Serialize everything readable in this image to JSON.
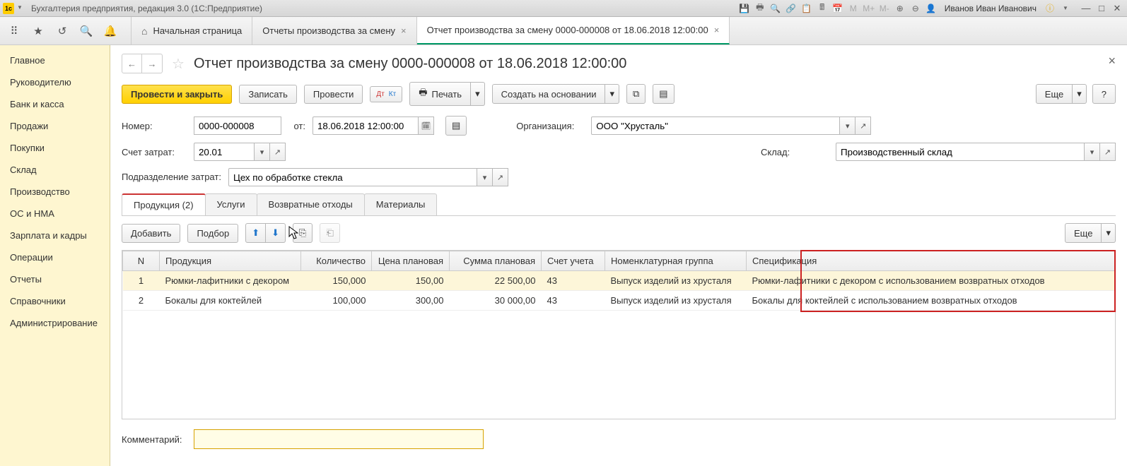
{
  "titlebar": {
    "app_title": "Бухгалтерия предприятия, редакция 3.0  (1С:Предприятие)",
    "user": "Иванов Иван Иванович"
  },
  "tabs": {
    "home": "Начальная страница",
    "tab1": "Отчеты производства за смену",
    "tab2": "Отчет производства за смену 0000-000008 от 18.06.2018 12:00:00"
  },
  "sidebar": {
    "items": [
      "Главное",
      "Руководителю",
      "Банк и касса",
      "Продажи",
      "Покупки",
      "Склад",
      "Производство",
      "ОС и НМА",
      "Зарплата и кадры",
      "Операции",
      "Отчеты",
      "Справочники",
      "Администрирование"
    ]
  },
  "page": {
    "title": "Отчет производства за смену 0000-000008 от 18.06.2018 12:00:00"
  },
  "actions": {
    "post_close": "Провести и закрыть",
    "write": "Записать",
    "post": "Провести",
    "print": "Печать",
    "create_based": "Создать на основании",
    "more": "Еще"
  },
  "form": {
    "number_label": "Номер:",
    "number": "0000-000008",
    "date_label": "от:",
    "date": "18.06.2018 12:00:00",
    "org_label": "Организация:",
    "org": "ООО \"Хрусталь\"",
    "cost_account_label": "Счет затрат:",
    "cost_account": "20.01",
    "warehouse_label": "Склад:",
    "warehouse": "Производственный склад",
    "dept_label": "Подразделение затрат:",
    "dept": "Цех по обработке стекла",
    "comment_label": "Комментарий:",
    "comment": ""
  },
  "inner_tabs": {
    "products": "Продукция (2)",
    "services": "Услуги",
    "returns": "Возвратные отходы",
    "materials": "Материалы"
  },
  "table_toolbar": {
    "add": "Добавить",
    "pick": "Подбор",
    "more": "Еще"
  },
  "table": {
    "headers": {
      "n": "N",
      "product": "Продукция",
      "qty": "Количество",
      "plan_price": "Цена плановая",
      "plan_sum": "Сумма плановая",
      "account": "Счет учета",
      "nom_group": "Номенклатурная группа",
      "spec": "Спецификация"
    },
    "rows": [
      {
        "n": "1",
        "product": "Рюмки-лафитники с декором",
        "qty": "150,000",
        "price": "150,00",
        "sum": "22 500,00",
        "acc": "43",
        "group": "Выпуск изделий из хрусталя",
        "spec": "Рюмки-лафитники с декором с использованием возвратных отходов"
      },
      {
        "n": "2",
        "product": "Бокалы для коктейлей",
        "qty": "100,000",
        "price": "300,00",
        "sum": "30 000,00",
        "acc": "43",
        "group": "Выпуск изделий из хрусталя",
        "spec": "Бокалы для коктейлей с использованием возвратных отходов"
      }
    ]
  }
}
